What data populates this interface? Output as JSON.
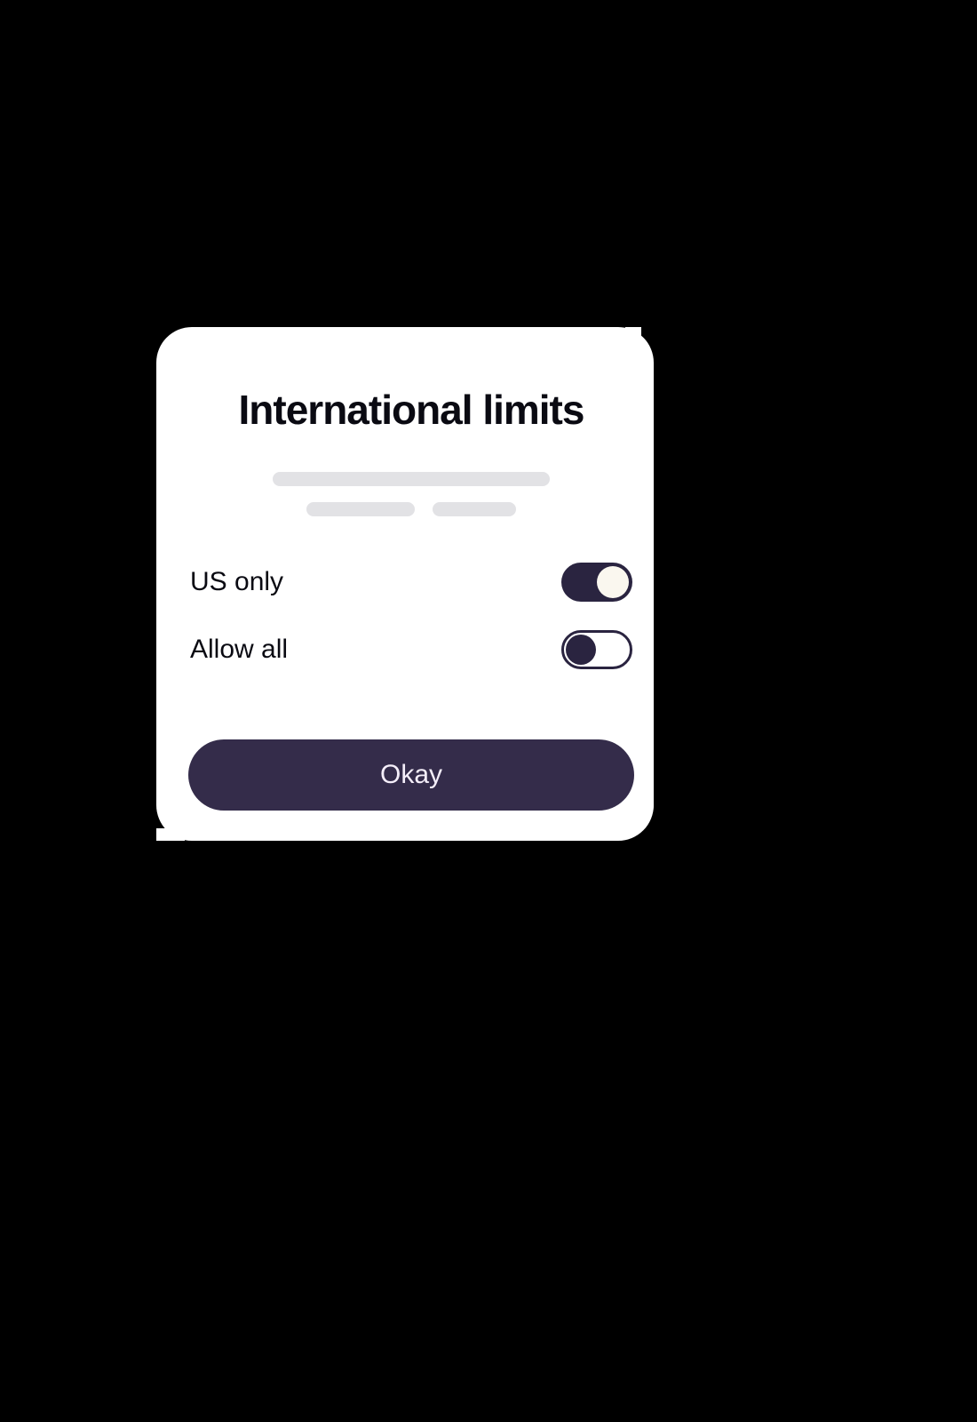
{
  "dialog": {
    "title": "International limits",
    "options": [
      {
        "label": "US only",
        "on": true
      },
      {
        "label": "Allow all",
        "on": false
      }
    ],
    "confirm_label": "Okay"
  },
  "colors": {
    "accent_dark": "#2a2440",
    "button_bg": "#342c4a",
    "card_bg": "#ffffff",
    "page_bg": "#000000",
    "skeleton": "#e2e2e5"
  }
}
